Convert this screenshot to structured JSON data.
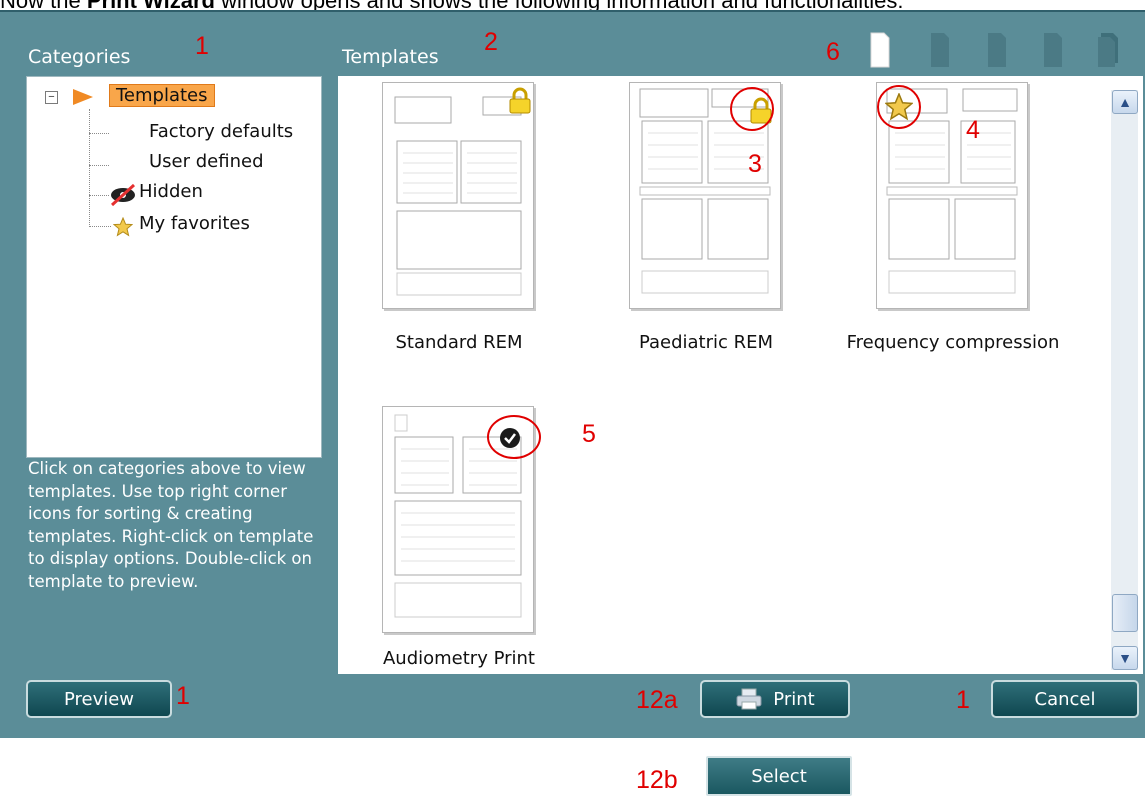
{
  "caption": {
    "pre": "Now the ",
    "bold": "Print Wizard",
    "post": " window opens and shows the following information and functionalities:"
  },
  "headers": {
    "categories": "Categories",
    "templates": "Templates"
  },
  "tree": {
    "root": "Templates",
    "children": [
      "Factory defaults",
      "User defined",
      "Hidden",
      "My favorites"
    ]
  },
  "help_text": "Click on categories above to view templates. Use top right corner icons for sorting & creating templates. Right-click on template to display options. Double-click on template to preview.",
  "templates": [
    {
      "name": "Standard REM",
      "badge": "lock"
    },
    {
      "name": "Paediatric REM",
      "badge": "lock"
    },
    {
      "name": "Frequency compression",
      "badge": "star"
    },
    {
      "name": "Audiometry Print",
      "badge": "check"
    }
  ],
  "buttons": {
    "preview": "Preview",
    "print": "Print",
    "cancel": "Cancel",
    "select": "Select"
  },
  "annotations": {
    "a1": "1",
    "a2": "2",
    "a3": "3",
    "a4": "4",
    "a5": "5",
    "a6": "6",
    "a1b": "1",
    "a12a": "12a",
    "a1c": "1",
    "a12b": "12b"
  },
  "colors": {
    "window_bg": "#5b8d98",
    "button_bg": "#1f5b64",
    "annotation_red": "#e00000",
    "selection_orange": "#f9a64a"
  },
  "icons": {
    "sort_new": "blank-page-icon",
    "sort_tools": "gray-page-icon"
  }
}
